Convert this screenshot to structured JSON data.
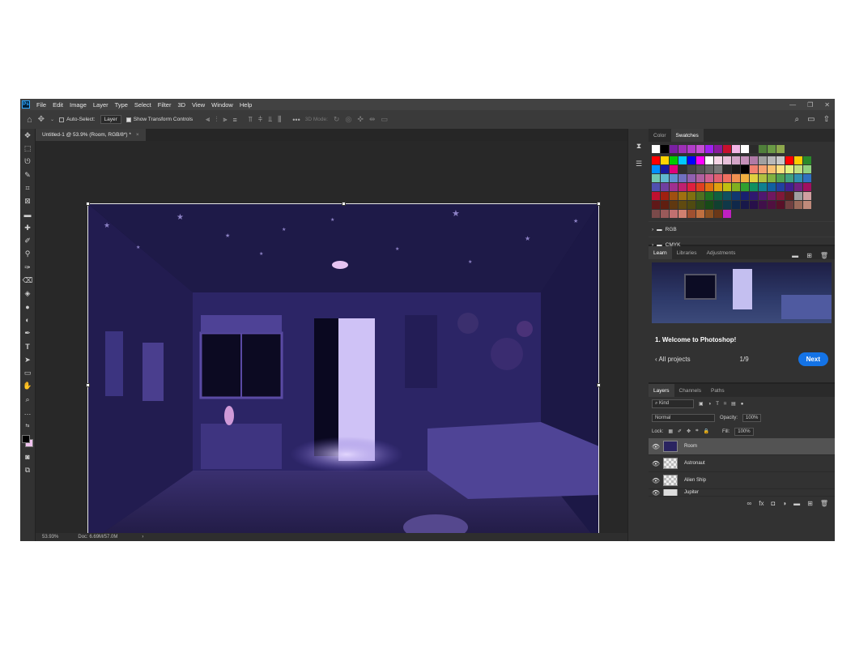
{
  "app": {
    "logo": "Ps"
  },
  "menu": [
    "File",
    "Edit",
    "Image",
    "Layer",
    "Type",
    "Select",
    "Filter",
    "3D",
    "View",
    "Window",
    "Help"
  ],
  "window_controls": {
    "minimize": "—",
    "restore": "❐",
    "close": "✕"
  },
  "options": {
    "auto_select_label": "Auto-Select:",
    "layer_dropdown": "Layer",
    "show_transform_label": "Show Transform Controls",
    "mode_3d": "3D Mode:",
    "more": "•••"
  },
  "document": {
    "tab": "Untitled-1 @ 53.9% (Room, RGB/8*) *",
    "zoom": "53.93%",
    "doc_size": "Doc: 6.69M/57.0M"
  },
  "swatches_panel": {
    "tabs": [
      "Color",
      "Swatches"
    ],
    "active_tab": "Swatches",
    "folders": [
      "RGB",
      "CMYK"
    ],
    "recent": [
      "#ffffff",
      "#000000",
      "#7a1fa2",
      "#9e2fb6",
      "#b13cc9",
      "#c64fd4",
      "#a020f0",
      "#8a1a9e",
      "#c8102e",
      "#f3b6e6",
      "#ffffff",
      "#2b2b2b",
      "#4f7f3a",
      "#6a9a45",
      "#8ea84d"
    ],
    "grid": [
      [
        "#ff0000",
        "#ffd400",
        "#00cc00",
        "#00c8ff",
        "#0000ff",
        "#ff00ff",
        "#ffffff",
        "#f5d5e6",
        "#e8c0da",
        "#d4a5c8",
        "#c490b8",
        "#b07aa6",
        "#a0a0a0",
        "#b8b8b8",
        "#c8c8c8",
        "#ff0000",
        "#ffcc00",
        "#2a8a2a"
      ],
      [
        "#0090ff",
        "#1a1aa0",
        "#e0007a",
        "#303030",
        "#444444",
        "#555555",
        "#666666",
        "#777777",
        "#2a2a2a",
        "#1a1a1a",
        "#000000",
        "#f08070",
        "#f5a070",
        "#f8c070",
        "#fde080",
        "#e0f080",
        "#c0e080",
        "#90d080"
      ],
      [
        "#70c8b0",
        "#60b8d0",
        "#6090d0",
        "#7070c0",
        "#9060b0",
        "#b060a0",
        "#d06090",
        "#e06070",
        "#f07060",
        "#f09050",
        "#f0b040",
        "#e0d040",
        "#b0c040",
        "#80b040",
        "#50a050",
        "#40a080",
        "#3090b0",
        "#3070c0"
      ],
      [
        "#5050b0",
        "#7040a0",
        "#a03090",
        "#c02070",
        "#e02040",
        "#e04020",
        "#e07010",
        "#e0a010",
        "#c0c010",
        "#80b020",
        "#30a030",
        "#109060",
        "#108090",
        "#1060a0",
        "#2040a0",
        "#402090",
        "#702080",
        "#a01060"
      ],
      [
        "#c01030",
        "#a02010",
        "#a05010",
        "#a07010",
        "#807010",
        "#507020",
        "#207020",
        "#106040",
        "#105060",
        "#103870",
        "#182070",
        "#301870",
        "#501870",
        "#701860",
        "#801838",
        "#602020",
        "#a0a0a0",
        "#d0a0a0"
      ],
      [
        "#601818",
        "#601e10",
        "#603810",
        "#604a10",
        "#504a10",
        "#304a18",
        "#184a18",
        "#104030",
        "#103848",
        "#10284a",
        "#18184a",
        "#28104a",
        "#40104a",
        "#501040",
        "#581028",
        "#704040",
        "#9a6a5a",
        "#c08a7a"
      ],
      [
        "#7a4a4a",
        "#9a5a5a",
        "#c07070",
        "#d08070",
        "#a05030",
        "#c07040",
        "#8a5020",
        "#6a3818",
        "#c020c0"
      ]
    ]
  },
  "panel_buttons": [
    "folder-icon",
    "new-icon",
    "trash-icon"
  ],
  "learn_panel": {
    "tabs": [
      "Learn",
      "Libraries",
      "Adjustments"
    ],
    "active_tab": "Learn",
    "title": "1. Welcome to Photoshop!",
    "back_label": "All projects",
    "progress": "1/9",
    "next_label": "Next"
  },
  "layers_panel": {
    "tabs": [
      "Layers",
      "Channels",
      "Paths"
    ],
    "active_tab": "Layers",
    "filter": "Kind",
    "blend_mode": "Normal",
    "opacity_label": "Opacity:",
    "opacity": "100%",
    "lock_label": "Lock:",
    "fill_label": "Fill:",
    "fill": "100%",
    "layers": [
      "Room",
      "Astronaut",
      "Alien Ship",
      "Jupiter"
    ],
    "selected": "Room",
    "footer_icons": [
      "link-icon",
      "fx-icon",
      "mask-icon",
      "adjustment-icon",
      "group-icon",
      "new-layer-icon",
      "trash-icon"
    ]
  },
  "colors": {
    "accent": "#1473e6",
    "bg_dark": "#2b2b2b",
    "panel": "#323232"
  }
}
